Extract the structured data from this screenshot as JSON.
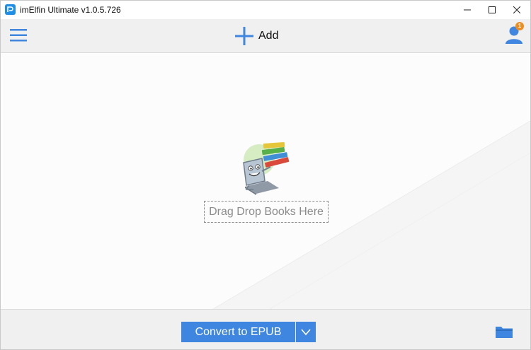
{
  "window": {
    "title": "imElfin Ultimate v1.0.5.726",
    "icon": "app-logo-icon"
  },
  "toolbar": {
    "menu_icon": "hamburger-menu-icon",
    "add_label": "Add",
    "add_icon": "plus-icon",
    "user_icon": "user-icon",
    "notification_count": "1"
  },
  "content": {
    "illustration": "book-reader-laptop-illustration",
    "drop_zone_text": "Drag Drop Books Here"
  },
  "bottom": {
    "convert_label": "Convert to EPUB",
    "dropdown_icon": "chevron-down-icon",
    "folder_icon": "folder-icon"
  },
  "colors": {
    "accent": "#3e86df",
    "badge": "#f08c1e",
    "toolbar_bg": "#f0f0f0"
  }
}
